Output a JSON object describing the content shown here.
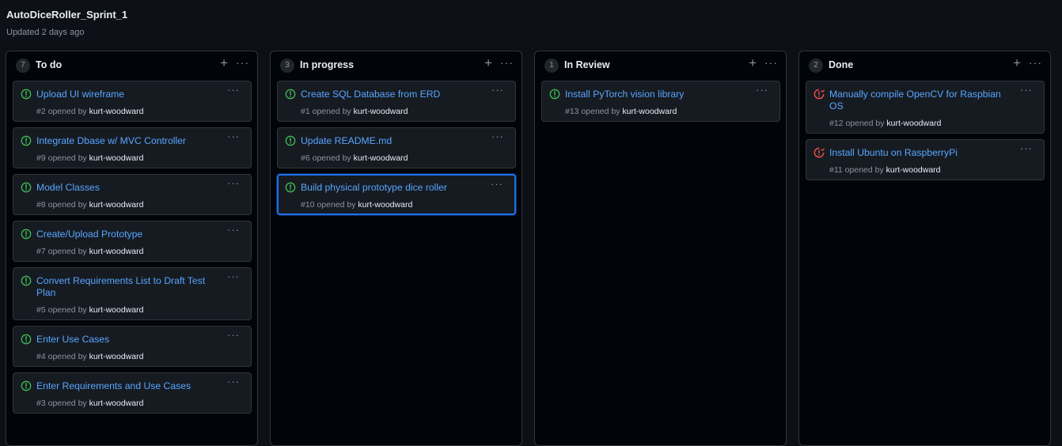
{
  "project": {
    "title": "AutoDiceRoller_Sprint_1",
    "updated": "Updated 2 days ago"
  },
  "colors": {
    "open": "#3fb950",
    "closed": "#f85149",
    "link": "#58a6ff"
  },
  "columns": [
    {
      "count": "7",
      "title": "To do",
      "add_icon": "plus-icon",
      "more_icon": "kebab-horizontal-icon",
      "cards": [
        {
          "title": "Upload UI wireframe",
          "number": "#2",
          "opened_by": "opened by",
          "user": "kurt-woodward",
          "state": "open",
          "more": "···"
        },
        {
          "title": "Integrate Dbase w/ MVC Controller",
          "number": "#9",
          "opened_by": "opened by",
          "user": "kurt-woodward",
          "state": "open",
          "more": "···"
        },
        {
          "title": "Model Classes",
          "number": "#8",
          "opened_by": "opened by",
          "user": "kurt-woodward",
          "state": "open",
          "more": "···"
        },
        {
          "title": "Create/Upload Prototype",
          "number": "#7",
          "opened_by": "opened by",
          "user": "kurt-woodward",
          "state": "open",
          "more": "···"
        },
        {
          "title": "Convert Requirements List to Draft Test Plan",
          "number": "#5",
          "opened_by": "opened by",
          "user": "kurt-woodward",
          "state": "open",
          "more": "···"
        },
        {
          "title": "Enter Use Cases",
          "number": "#4",
          "opened_by": "opened by",
          "user": "kurt-woodward",
          "state": "open",
          "more": "···"
        },
        {
          "title": "Enter Requirements and Use Cases",
          "number": "#3",
          "opened_by": "opened by",
          "user": "kurt-woodward",
          "state": "open",
          "more": "···"
        }
      ]
    },
    {
      "count": "3",
      "title": "In progress",
      "add_icon": "plus-icon",
      "more_icon": "kebab-horizontal-icon",
      "cards": [
        {
          "title": "Create SQL Database from ERD",
          "number": "#1",
          "opened_by": "opened by",
          "user": "kurt-woodward",
          "state": "open",
          "more": "···"
        },
        {
          "title": "Update README.md",
          "number": "#6",
          "opened_by": "opened by",
          "user": "kurt-woodward",
          "state": "open",
          "more": "···"
        },
        {
          "title": "Build physical prototype dice roller",
          "number": "#10",
          "opened_by": "opened by",
          "user": "kurt-woodward",
          "state": "open",
          "selected": true,
          "more": "···"
        }
      ]
    },
    {
      "count": "1",
      "title": "In Review",
      "add_icon": "plus-icon",
      "more_icon": "kebab-horizontal-icon",
      "cards": [
        {
          "title": "Install PyTorch vision library",
          "number": "#13",
          "opened_by": "opened by",
          "user": "kurt-woodward",
          "state": "open",
          "more": "···"
        }
      ]
    },
    {
      "count": "2",
      "title": "Done",
      "add_icon": "plus-icon",
      "more_icon": "kebab-horizontal-icon",
      "cards": [
        {
          "title": "Manually compile OpenCV for Raspbian OS",
          "number": "#12",
          "opened_by": "opened by",
          "user": "kurt-woodward",
          "state": "closed",
          "more": "···"
        },
        {
          "title": "Install Ubuntu on RaspberryPi",
          "number": "#11",
          "opened_by": "opened by",
          "user": "kurt-woodward",
          "state": "closed",
          "more": "···"
        }
      ]
    }
  ]
}
